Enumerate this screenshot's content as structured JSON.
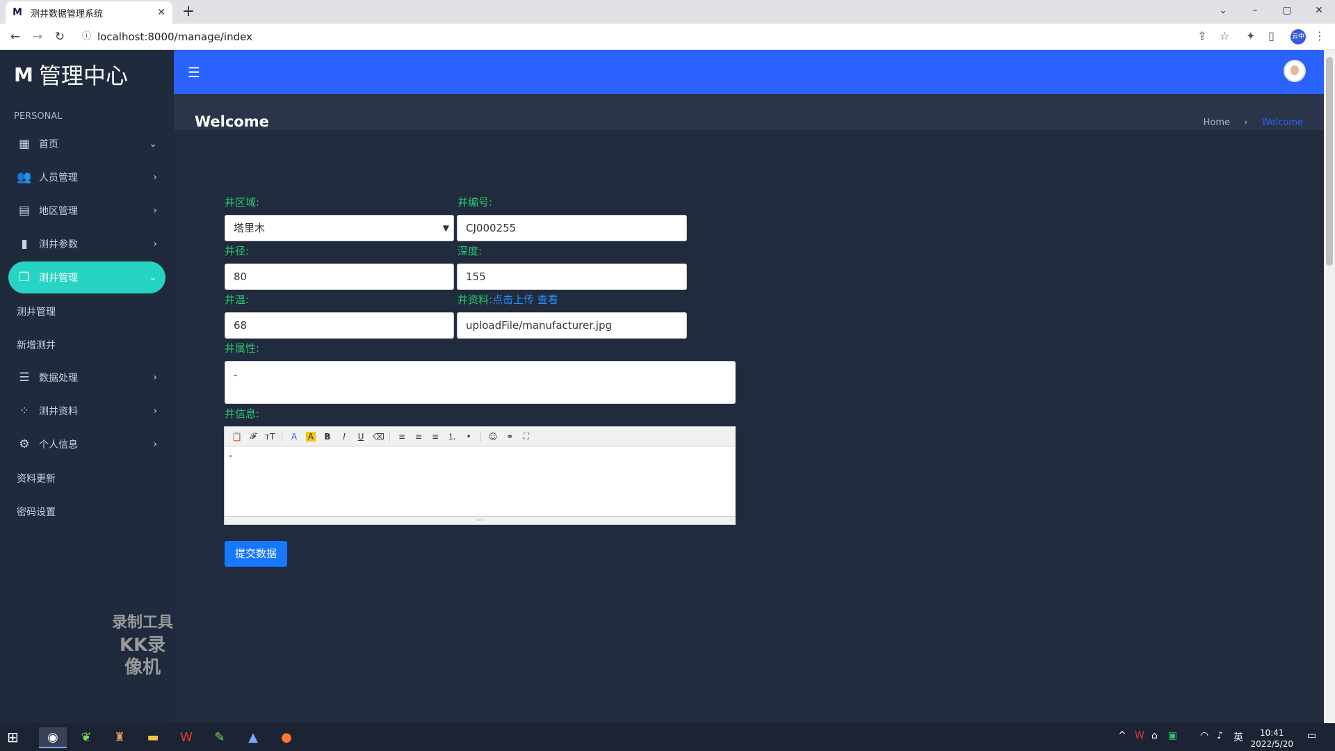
{
  "browser": {
    "tab_title": "测井数据管理系统",
    "url": "localhost:8000/manage/index",
    "profile_label": "云中",
    "window_buttons": [
      "⌄",
      "–",
      "▢",
      "✕"
    ]
  },
  "sidebar": {
    "logo_letter": "M",
    "logo_text": "管理中心",
    "section_label": "PERSONAL",
    "items": [
      {
        "label": "首页",
        "icon": "dashboard-icon",
        "glyph": "▦",
        "chevron": "⌄"
      },
      {
        "label": "人员管理",
        "icon": "users-icon",
        "glyph": "👥",
        "chevron": "›"
      },
      {
        "label": "地区管理",
        "icon": "list-box-icon",
        "glyph": "▤",
        "chevron": "›"
      },
      {
        "label": "测井参数",
        "icon": "equalizer-icon",
        "glyph": "▮",
        "chevron": "›"
      },
      {
        "label": "测井管理",
        "icon": "copy-icon",
        "glyph": "❐",
        "chevron": "⌄",
        "active": true
      },
      {
        "label": "数据处理",
        "icon": "list-icon",
        "glyph": "☰",
        "chevron": "›"
      },
      {
        "label": "测井资料",
        "icon": "dots-grid-icon",
        "glyph": "⁘",
        "chevron": "›"
      },
      {
        "label": "个人信息",
        "icon": "gear-icon",
        "glyph": "⚙",
        "chevron": "›"
      }
    ],
    "subitems_group1": [
      "测井管理",
      "新增测井"
    ],
    "subitems_group2": [
      "资料更新",
      "密码设置"
    ],
    "watermark_line1": "录制工具",
    "watermark_line2": "KK录像机"
  },
  "header": {
    "page_title": "Welcome",
    "breadcrumb_home": "Home",
    "breadcrumb_sep": "›",
    "breadcrumb_current": "Welcome"
  },
  "form": {
    "area_label": "井区域:",
    "area_value": "塔里木",
    "code_label": "井编号:",
    "code_value": "CJ000255",
    "diameter_label": "井径:",
    "diameter_value": "80",
    "depth_label": "深度:",
    "depth_value": "155",
    "temp_label": "井温:",
    "temp_value": "68",
    "file_label": "井资料:",
    "upload_link": "点击上传",
    "view_link": "查看",
    "file_value": "uploadFile/manufacturer.jpg",
    "property_label": "井属性:",
    "property_value": "-",
    "info_label": "井信息:",
    "info_value": "-",
    "submit_label": "提交数据"
  },
  "editor_toolbar": [
    "📋",
    "𝓕",
    "тT",
    "A",
    "A",
    "B",
    "I",
    "U",
    "⌫",
    "≡",
    "≡",
    "≡",
    "⒈",
    "•",
    "☺",
    "⚭",
    "⛶"
  ],
  "taskbar": {
    "time": "10:41",
    "date": "2022/5/20",
    "ime": "英",
    "apps": [
      "chrome-icon",
      "leaf-app-icon",
      "game-app-icon",
      "folder-icon",
      "wps-icon",
      "notepad-icon",
      "photos-icon",
      "recorder-icon"
    ]
  },
  "colors": {
    "accent": "#2962ff",
    "active_menu": "#26d4c4",
    "label_green": "#29c770",
    "link_blue": "#2f8cff",
    "submit_blue": "#1677ff"
  }
}
